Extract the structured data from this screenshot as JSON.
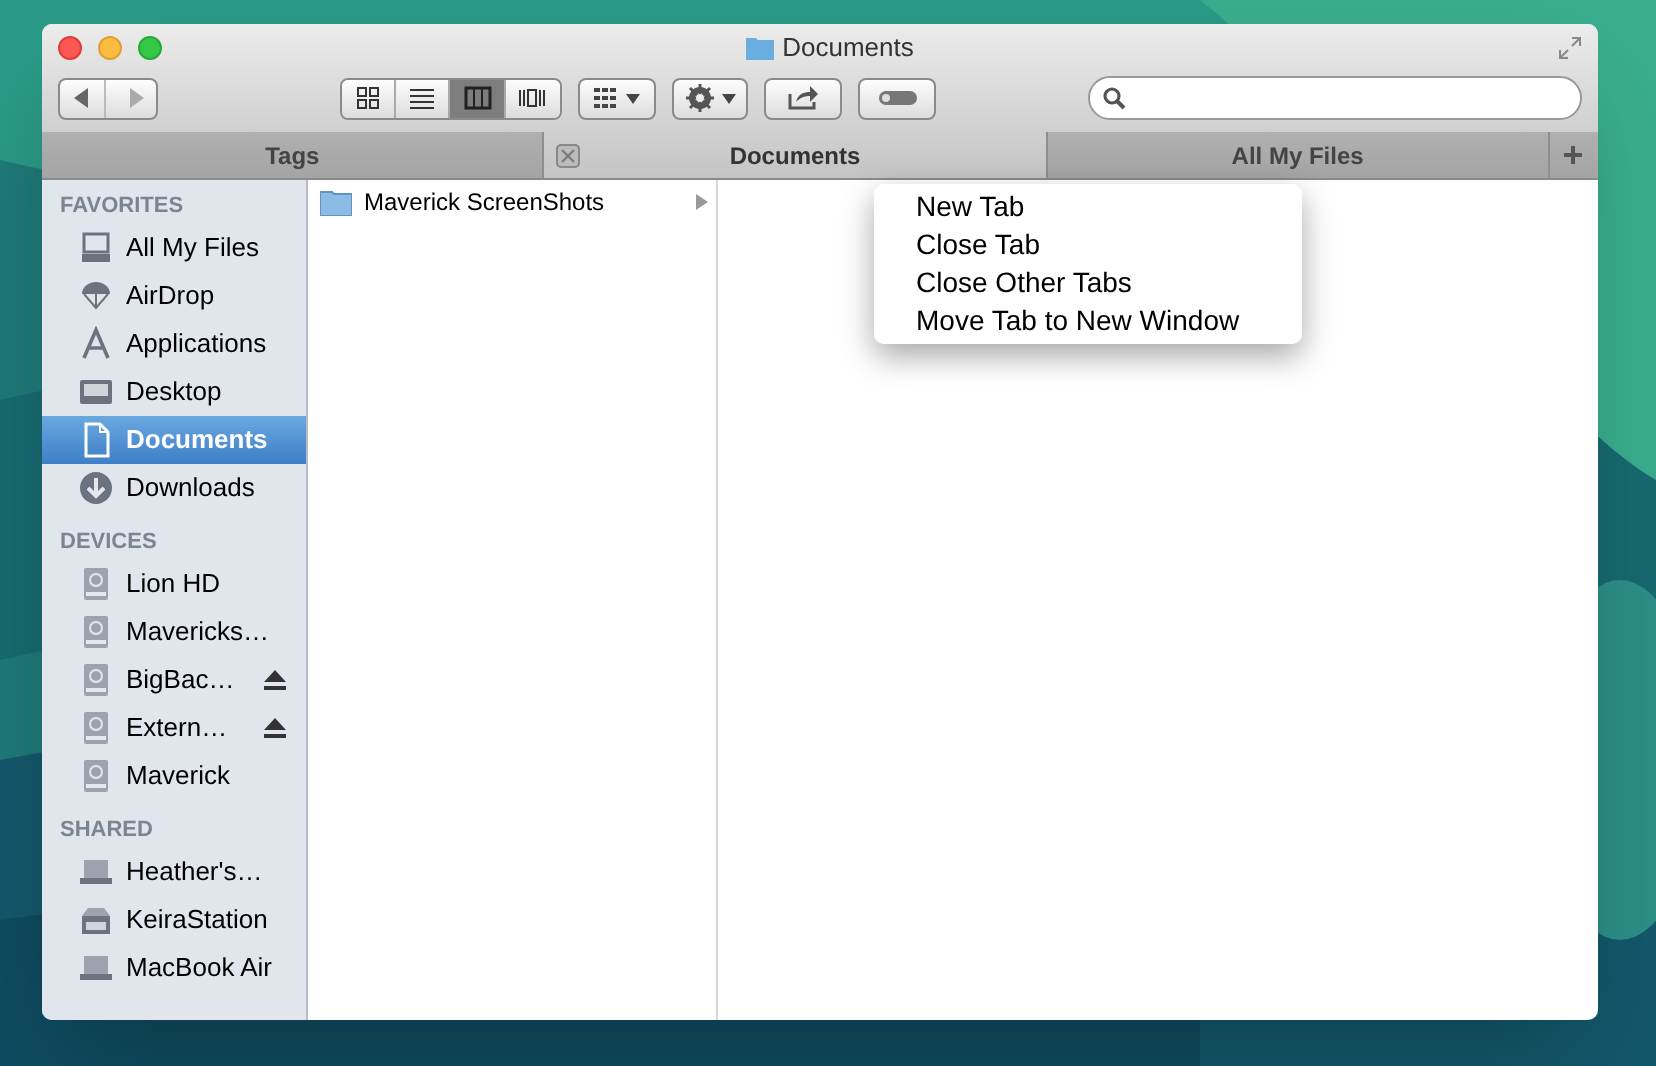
{
  "window": {
    "title": "Documents"
  },
  "view_buttons": [
    {
      "kind": "icons",
      "selected": false
    },
    {
      "kind": "list",
      "selected": false
    },
    {
      "kind": "columns",
      "selected": true
    },
    {
      "kind": "coverflow",
      "selected": false
    }
  ],
  "tabs": [
    {
      "label": "Tags",
      "selected": false
    },
    {
      "label": "Documents",
      "selected": true
    },
    {
      "label": "All My Files",
      "selected": false
    }
  ],
  "sidebar": [
    {
      "heading": "FAVORITES",
      "items": [
        {
          "label": "All My Files",
          "kind": "files",
          "selected": false,
          "eject": false
        },
        {
          "label": "AirDrop",
          "kind": "airdrop",
          "selected": false,
          "eject": false
        },
        {
          "label": "Applications",
          "kind": "apps",
          "selected": false,
          "eject": false
        },
        {
          "label": "Desktop",
          "kind": "desktop",
          "selected": false,
          "eject": false
        },
        {
          "label": "Documents",
          "kind": "documents",
          "selected": true,
          "eject": false
        },
        {
          "label": "Downloads",
          "kind": "downloads",
          "selected": false,
          "eject": false
        }
      ]
    },
    {
      "heading": "DEVICES",
      "items": [
        {
          "label": "Lion HD",
          "kind": "disk",
          "selected": false,
          "eject": false
        },
        {
          "label": "Mavericks…",
          "kind": "disk",
          "selected": false,
          "eject": false
        },
        {
          "label": "BigBac…",
          "kind": "disk",
          "selected": false,
          "eject": true
        },
        {
          "label": "Extern…",
          "kind": "disk",
          "selected": false,
          "eject": true
        },
        {
          "label": "Maverick",
          "kind": "disk",
          "selected": false,
          "eject": false
        }
      ]
    },
    {
      "heading": "SHARED",
      "items": [
        {
          "label": "Heather's…",
          "kind": "laptop",
          "selected": false,
          "eject": false
        },
        {
          "label": "KeiraStation",
          "kind": "server",
          "selected": false,
          "eject": false
        },
        {
          "label": "MacBook Air",
          "kind": "laptop",
          "selected": false,
          "eject": false
        }
      ]
    }
  ],
  "column": [
    {
      "label": "Maverick ScreenShots",
      "selected": false
    }
  ],
  "context_menu": [
    "New Tab",
    "Close Tab",
    "Close Other Tabs",
    "Move Tab to New Window"
  ]
}
